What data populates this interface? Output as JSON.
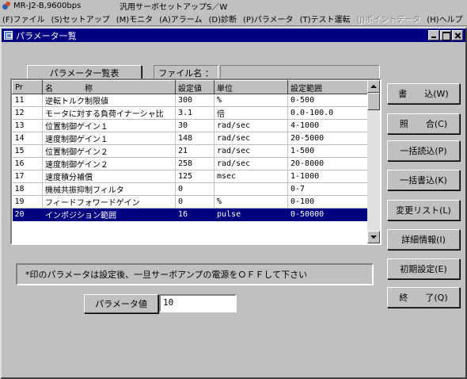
{
  "app": {
    "connection": "MR-J2-B,9600bps",
    "title": "汎用サーボセットアップS／W"
  },
  "menu": [
    {
      "label": "(F)ファイル",
      "disabled": false
    },
    {
      "label": "(S)セットアップ",
      "disabled": false
    },
    {
      "label": "(M)モニタ",
      "disabled": false
    },
    {
      "label": "(A)アラーム",
      "disabled": false
    },
    {
      "label": "(D)診断",
      "disabled": false
    },
    {
      "label": "(P)パラメータ",
      "disabled": false
    },
    {
      "label": "(T)テスト運転",
      "disabled": false
    },
    {
      "label": "(J)ポイントデータ",
      "disabled": true
    },
    {
      "label": "(H)ヘルプ",
      "disabled": false
    }
  ],
  "window": {
    "title": "パラメータ一覧"
  },
  "top": {
    "list_button": "パラメータ一覧表",
    "file_label": "ファイル名 ：",
    "file_value": ""
  },
  "table": {
    "headers": [
      "Pr",
      "名　　　　称",
      "設定値",
      "単位",
      "設定範囲"
    ],
    "rows": [
      {
        "pr": "11",
        "name": "逆転トルク制限値",
        "value": "300",
        "unit": "%",
        "range": "0-500"
      },
      {
        "pr": "12",
        "name": "モータに対する負荷イナーシャ比",
        "value": "3.1",
        "unit": "倍",
        "range": "0.0-100.0"
      },
      {
        "pr": "13",
        "name": "位置制御ゲイン１",
        "value": "30",
        "unit": "rad/sec",
        "range": "4-1000"
      },
      {
        "pr": "14",
        "name": "速度制御ゲイン１",
        "value": "148",
        "unit": "rad/sec",
        "range": "20-5000"
      },
      {
        "pr": "15",
        "name": "位置制御ゲイン２",
        "value": "21",
        "unit": "rad/sec",
        "range": "1-500"
      },
      {
        "pr": "16",
        "name": "速度制御ゲイン２",
        "value": "258",
        "unit": "rad/sec",
        "range": "20-8000"
      },
      {
        "pr": "17",
        "name": "速度積分補償",
        "value": "125",
        "unit": "msec",
        "range": "1-1000"
      },
      {
        "pr": "18",
        "name": "機械共振抑制フィルタ",
        "value": "0",
        "unit": "",
        "range": "0-7"
      },
      {
        "pr": "19",
        "name": "フィードフォワードゲイン",
        "value": "0",
        "unit": "%",
        "range": "0-100"
      },
      {
        "pr": "20",
        "name": "インポジション範囲",
        "value": "16",
        "unit": "pulse",
        "range": "0-50000"
      }
    ],
    "selected_index": 9
  },
  "buttons": [
    {
      "name": "write-button",
      "label": "書　　込(W)"
    },
    {
      "name": "compare-button",
      "label": "照　　合(C)"
    },
    {
      "name": "batch-read-button",
      "label": "一括読込(P)"
    },
    {
      "name": "batch-write-button",
      "label": "一括書込(K)"
    },
    {
      "name": "change-list-button",
      "label": "変更リスト(L)"
    },
    {
      "name": "detail-info-button",
      "label": "詳細情報(I)"
    },
    {
      "name": "initial-setting-button",
      "label": "初期設定(E)"
    },
    {
      "name": "exit-button",
      "label": "終　　了(Q)"
    }
  ],
  "notice": "*印のパラメータは設定後、一旦サーボアンプの電源をＯＦＦして下さい",
  "param_value": {
    "label": "パラメータ値",
    "value": "10"
  },
  "colors": {
    "selection": "#000080",
    "window_bg": "#c0c0c0",
    "titlebar": "#000080"
  }
}
